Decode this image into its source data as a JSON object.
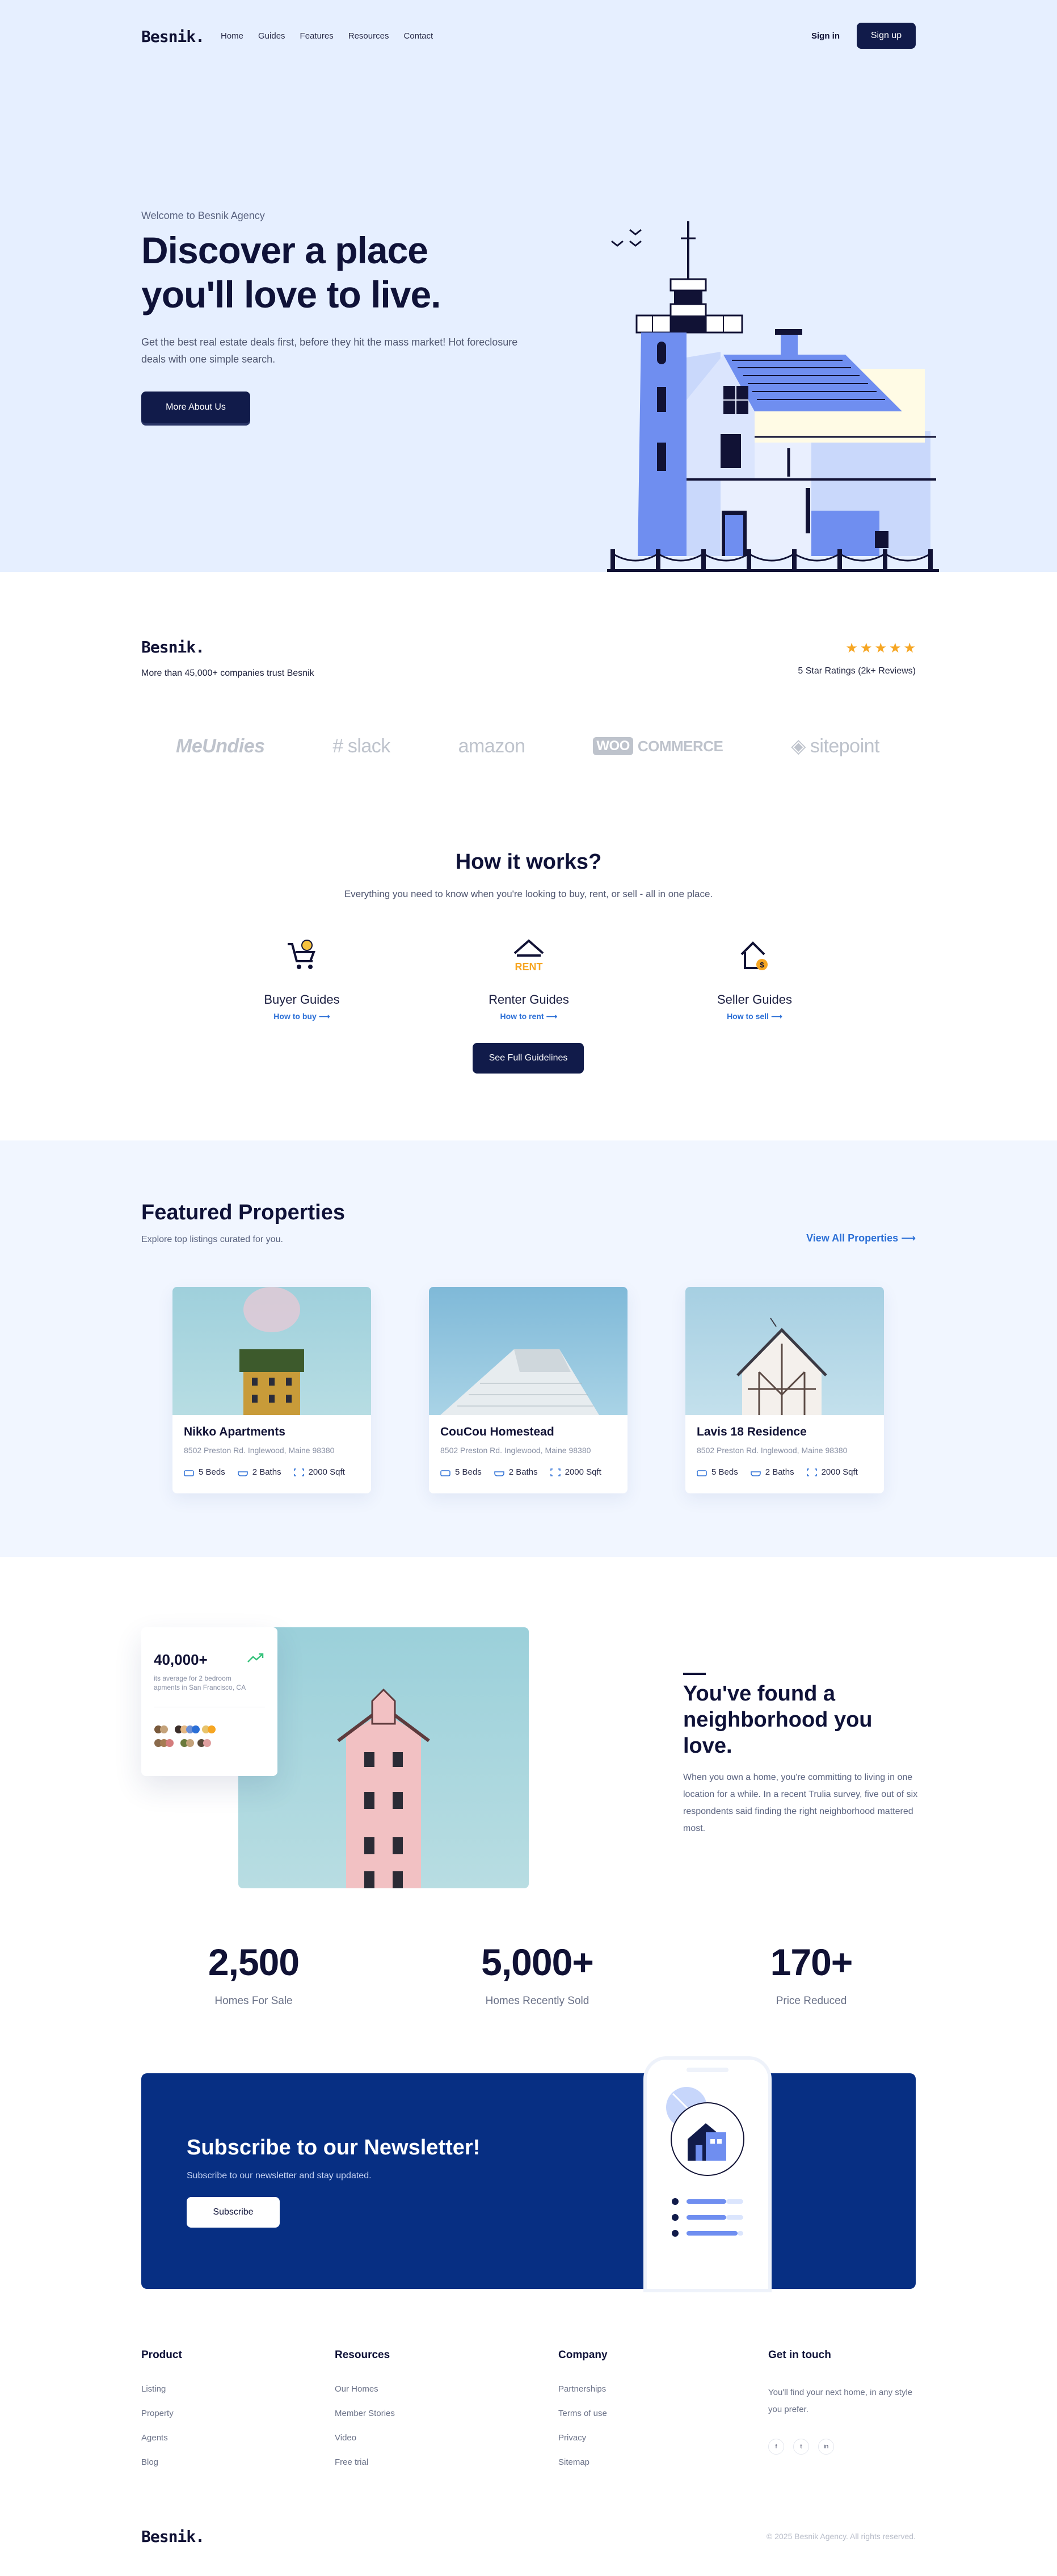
{
  "brand": {
    "name": "Besnik."
  },
  "nav": {
    "links": [
      "Home",
      "Guides",
      "Features",
      "Resources",
      "Contact"
    ],
    "signin": "Sign in",
    "signup": "Sign up"
  },
  "hero": {
    "eyebrow": "Welcome to Besnik Agency",
    "title_line1": "Discover a place",
    "title_line2": "you'll love to live.",
    "subtitle": "Get the best real estate deals first, before they hit the mass market! Hot foreclosure deals with one simple search.",
    "button": "More About Us"
  },
  "trust": {
    "text": "More than 45,000+ companies trust Besnik",
    "stars": 5,
    "rating": "5 Star Ratings (2k+ Reviews)",
    "brands": [
      "MeUndies",
      "slack",
      "amazon",
      "WOO",
      "COMMERCE",
      "sitepoint"
    ]
  },
  "how": {
    "title": "How it works?",
    "subtitle": "Everything you need to know when you're looking to buy, rent, or sell - all in one place.",
    "guides": [
      {
        "title": "Buyer Guides",
        "link": "How to buy",
        "icon": "shopping-cart-icon"
      },
      {
        "title": "Renter Guides",
        "link": "How to rent",
        "icon": "rent-house-icon"
      },
      {
        "title": "Seller Guides",
        "link": "How to sell",
        "icon": "sell-house-icon"
      }
    ],
    "button": "See Full Guidelines"
  },
  "featured": {
    "title": "Featured Properties",
    "subtitle": "Explore top listings curated for you.",
    "view_all": "View All Properties",
    "cards": [
      {
        "name": "Nikko Apartments",
        "address": "8502 Preston Rd. Inglewood, Maine 98380",
        "beds": "5 Beds",
        "baths": "2 Baths",
        "area": "2000 Sqft"
      },
      {
        "name": "CouCou Homestead",
        "address": "8502 Preston Rd. Inglewood, Maine 98380",
        "beds": "5 Beds",
        "baths": "2 Baths",
        "area": "2000 Sqft"
      },
      {
        "name": "Lavis 18 Residence",
        "address": "8502 Preston Rd. Inglewood, Maine 98380",
        "beds": "5 Beds",
        "baths": "2 Baths",
        "area": "2000 Sqft"
      }
    ]
  },
  "neighborhood": {
    "stat_number": "40,000+",
    "stat_desc": "its average for 2 bedroom apments in San Francisco, CA",
    "title": "You've found a neighborhood you love.",
    "text": "When you own a home, you're committing to living in one location for a while. In a recent Trulia survey, five out of six respondents said finding the right neighborhood mattered most."
  },
  "stats": [
    {
      "number": "2,500",
      "label": "Homes For Sale"
    },
    {
      "number": "5,000+",
      "label": "Homes Recently Sold"
    },
    {
      "number": "170+",
      "label": "Price Reduced"
    }
  ],
  "newsletter": {
    "title": "Subscribe to our Newsletter!",
    "subtitle": "Subscribe to our newsletter and stay updated.",
    "button": "Subscribe"
  },
  "footer": {
    "product": {
      "title": "Product",
      "links": [
        "Listing",
        "Property",
        "Agents",
        "Blog"
      ]
    },
    "resources": {
      "title": "Resources",
      "links": [
        "Our Homes",
        "Member Stories",
        "Video",
        "Free trial"
      ]
    },
    "company": {
      "title": "Company",
      "links": [
        "Partnerships",
        "Terms of use",
        "Privacy",
        "Sitemap"
      ]
    },
    "contact": {
      "title": "Get in touch",
      "text": "You'll find your next home, in any style you prefer.",
      "socials": [
        "f",
        "t",
        "in"
      ]
    },
    "copyright": "© 2025 Besnik Agency. All rights reserved."
  },
  "colors": {
    "hero_bg": "#e6efff",
    "primary": "#111b4a",
    "accent": "#2b6fd6",
    "newsletter_bg": "#072f83",
    "star": "#f6a623"
  }
}
